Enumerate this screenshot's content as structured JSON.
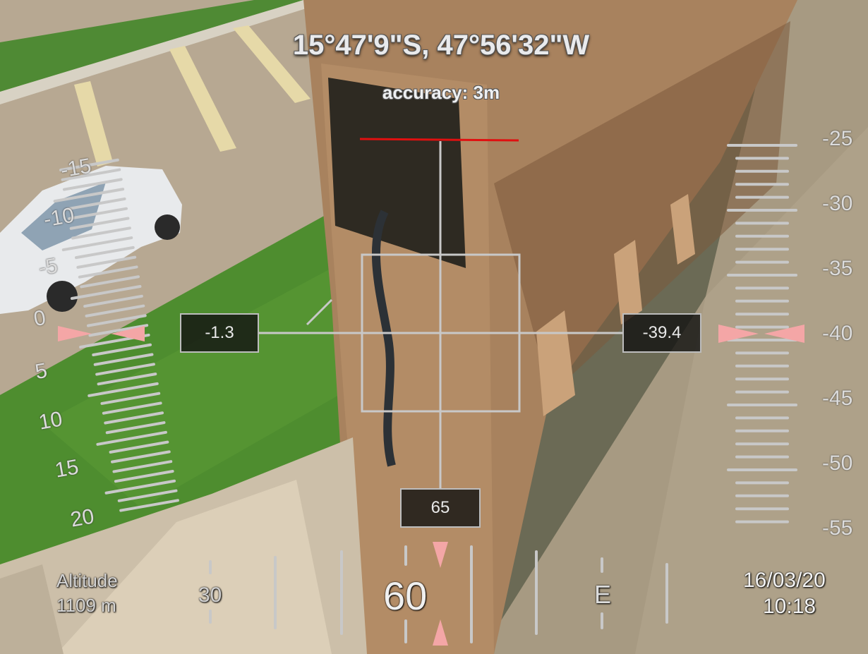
{
  "location": {
    "coordinates": "15°47'9\"S, 47°56'32\"W",
    "accuracy": "accuracy: 3m"
  },
  "readouts": {
    "roll": "-1.3",
    "pitch": "-39.4",
    "vertical": "65"
  },
  "left_scale": {
    "labels": [
      "-15",
      "-10",
      "-5",
      "0",
      "5",
      "10",
      "15",
      "20"
    ]
  },
  "right_scale": {
    "labels": [
      "-25",
      "-30",
      "-35",
      "-40",
      "-45",
      "-50",
      "-55"
    ]
  },
  "heading": {
    "current": "60",
    "minor_label": "30",
    "cardinal": "E"
  },
  "altitude": {
    "label": "Altitude",
    "value": "1109 m"
  },
  "datetime": {
    "date": "16/03/20",
    "time": "10:18"
  },
  "colors": {
    "hud_line": "#c8c8c8",
    "marker": "#f4a6a6",
    "horizon_red": "#e01010"
  }
}
